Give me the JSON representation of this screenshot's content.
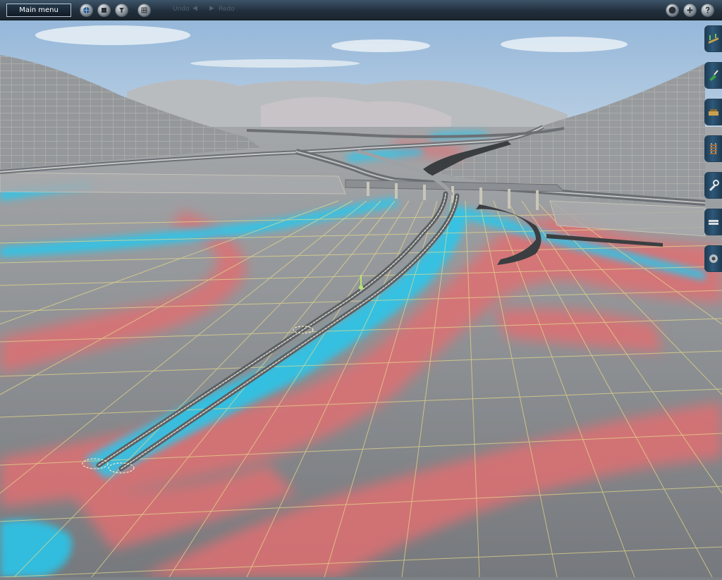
{
  "toolbar": {
    "main_menu_label": "Main menu",
    "icons": [
      "globe-icon",
      "stop-icon",
      "camera-icon",
      "grid-icon"
    ],
    "undo_label": "Undo",
    "redo_label": "Redo",
    "right_icons": [
      "sphere-icon",
      "add-icon",
      "help-icon"
    ]
  },
  "side_tabs": [
    "track-tool-icon",
    "paint-tool-icon",
    "object-tool-icon",
    "rail-tool-icon",
    "wrench-tool-icon",
    "layers-tool-icon",
    "settings-tool-icon"
  ],
  "colors": {
    "sky_top": "#93b5d9",
    "sky_bottom": "#d2e0ea",
    "terrain_base": "#7d8287",
    "grid_line": "#e8dc8a",
    "height_red": "#df6f72",
    "height_blue": "#28c8ee",
    "toolbar": "#22303d",
    "tab": "#2e5878"
  }
}
